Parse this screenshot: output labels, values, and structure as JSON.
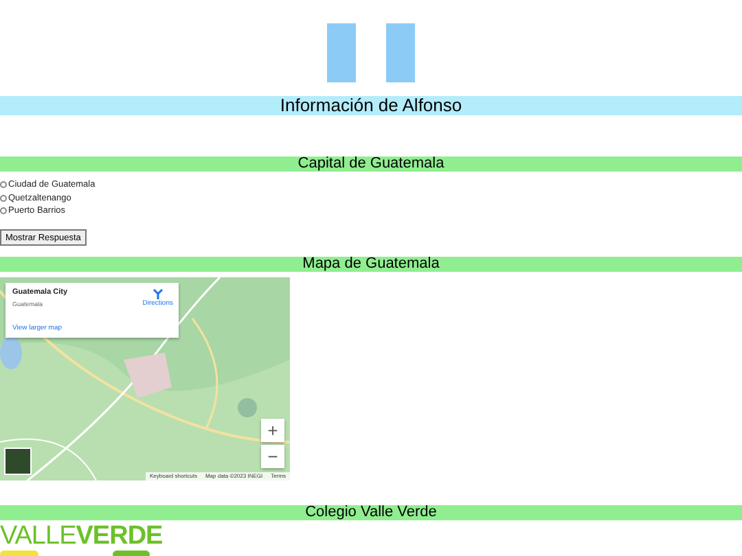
{
  "title": "Información de Alfonso",
  "quiz": {
    "heading": "Capital de Guatemala",
    "options": [
      {
        "label": "Ciudad de Guatemala",
        "selected": false
      },
      {
        "label": "Quetzaltenango",
        "selected": false
      },
      {
        "label": "Puerto Barrios",
        "selected": false
      }
    ],
    "button": "Mostrar Respuesta"
  },
  "map": {
    "heading": "Mapa de Guatemala",
    "place_title": "Guatemala City",
    "place_subtitle": "Guatemala",
    "directions": "Directions",
    "larger_map_link": "View larger map",
    "zoom_in": "+",
    "zoom_out": "−",
    "footer": [
      "Keyboard shortcuts",
      "Map data ©2023 INEGI",
      "Terms"
    ]
  },
  "school": {
    "heading": "Colegio Valle Verde",
    "logo": "VALLE**VERDE**"
  }
}
